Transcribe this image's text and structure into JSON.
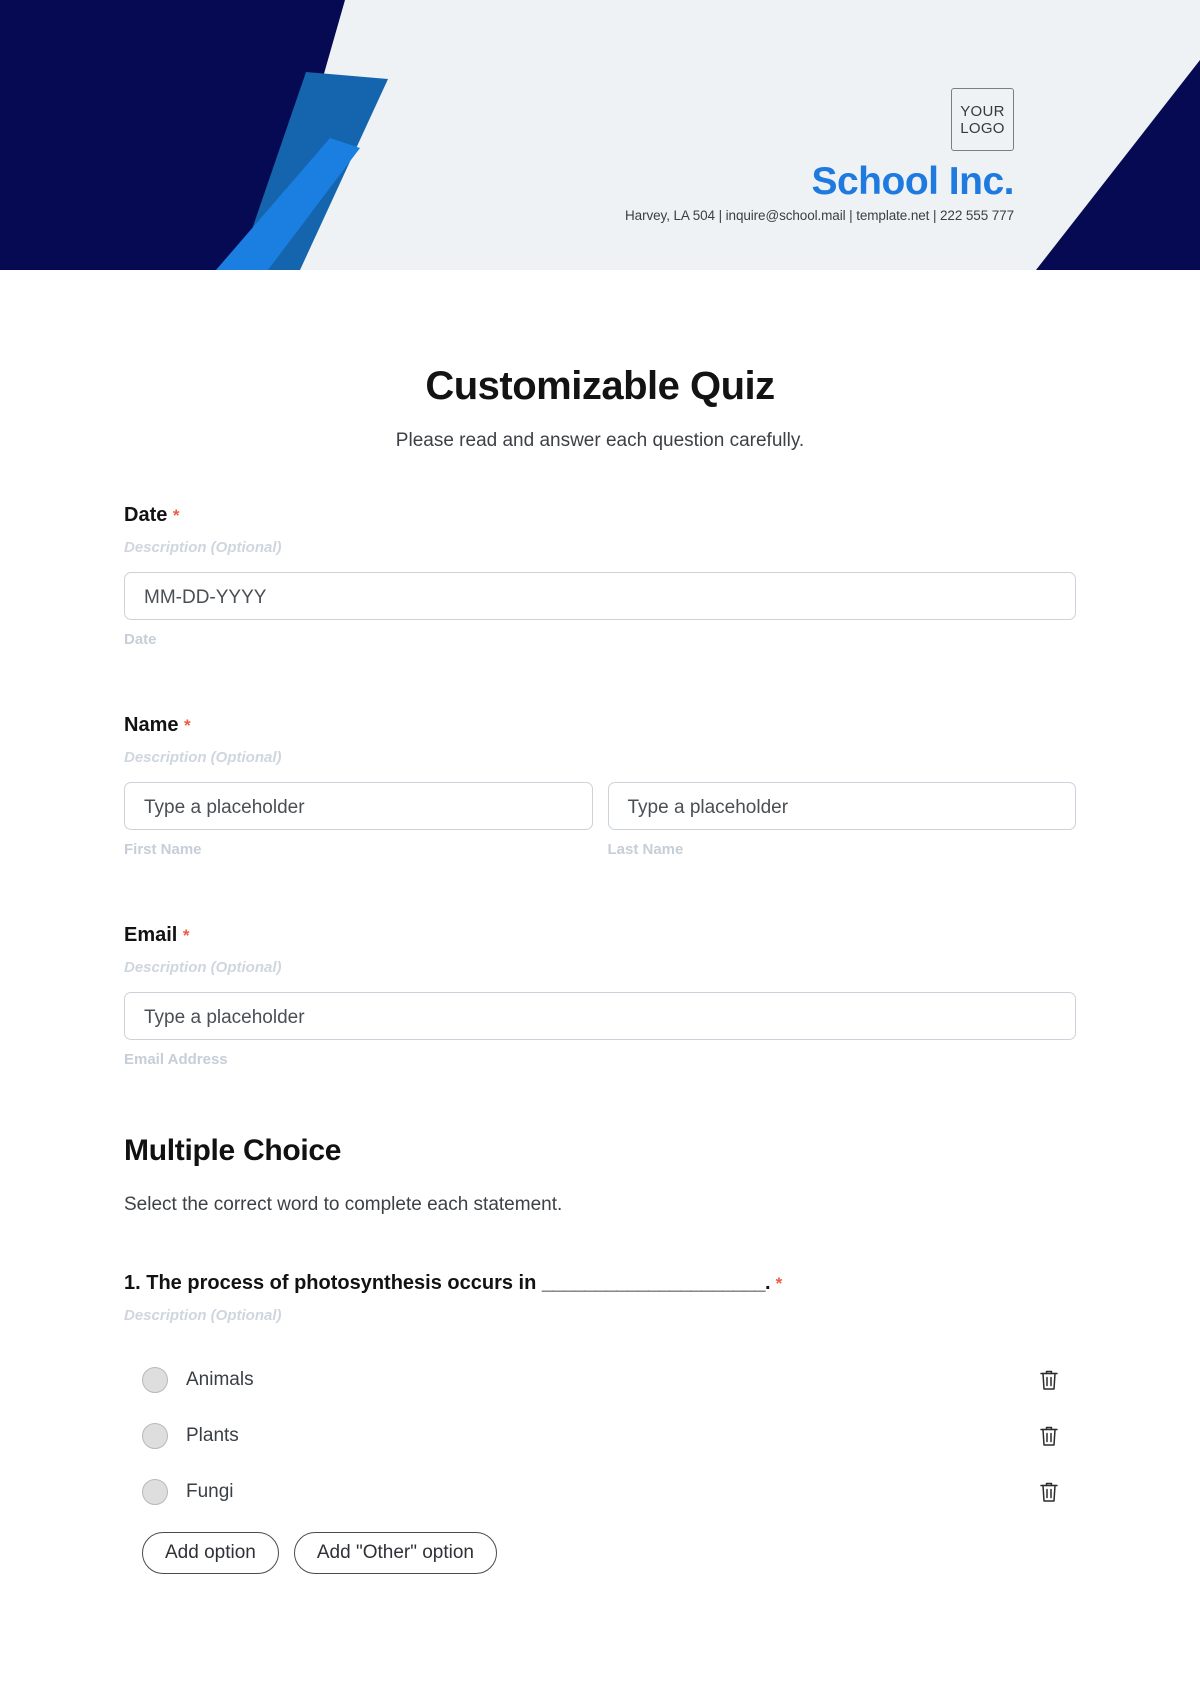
{
  "header": {
    "logo_line1": "YOUR",
    "logo_line2": "LOGO",
    "brand_name": "School Inc.",
    "contact": "Harvey, LA 504 | inquire@school.mail | template.net | 222 555 777",
    "colors": {
      "background": "#eef2f5",
      "navy": "#060a52",
      "blue_bright": "#1a7fe0",
      "blue_mid": "#1464ae",
      "blue_dark": "#15568f",
      "brand_text": "#1f7ae0"
    }
  },
  "form": {
    "title": "Customizable Quiz",
    "subtitle": "Please read and answer each question carefully.",
    "required_mark": "*",
    "description_placeholder": "Description (Optional)",
    "fields": [
      {
        "label": "Date",
        "description": "Description (Optional)",
        "inputs": [
          {
            "placeholder": "MM-DD-YYYY",
            "sub_label": "Date"
          }
        ]
      },
      {
        "label": "Name",
        "description": "Description (Optional)",
        "inputs": [
          {
            "placeholder": "Type a placeholder",
            "sub_label": "First Name"
          },
          {
            "placeholder": "Type a placeholder",
            "sub_label": "Last Name"
          }
        ]
      },
      {
        "label": "Email",
        "description": "Description (Optional)",
        "inputs": [
          {
            "placeholder": "Type a placeholder",
            "sub_label": "Email Address"
          }
        ]
      }
    ]
  },
  "section": {
    "title": "Multiple Choice",
    "subtitle": "Select the correct word to complete each statement.",
    "question": {
      "number": "1.",
      "text": "The process of photosynthesis occurs in",
      "blank": "_____________________.",
      "required_mark": "*",
      "description": "Description (Optional)",
      "options": [
        {
          "label": "Animals",
          "delete_icon": "trash-icon"
        },
        {
          "label": "Plants",
          "delete_icon": "trash-icon"
        },
        {
          "label": "Fungi",
          "delete_icon": "trash-icon"
        }
      ],
      "buttons": {
        "add_option": "Add option",
        "add_other_option": "Add \"Other\" option"
      }
    }
  }
}
